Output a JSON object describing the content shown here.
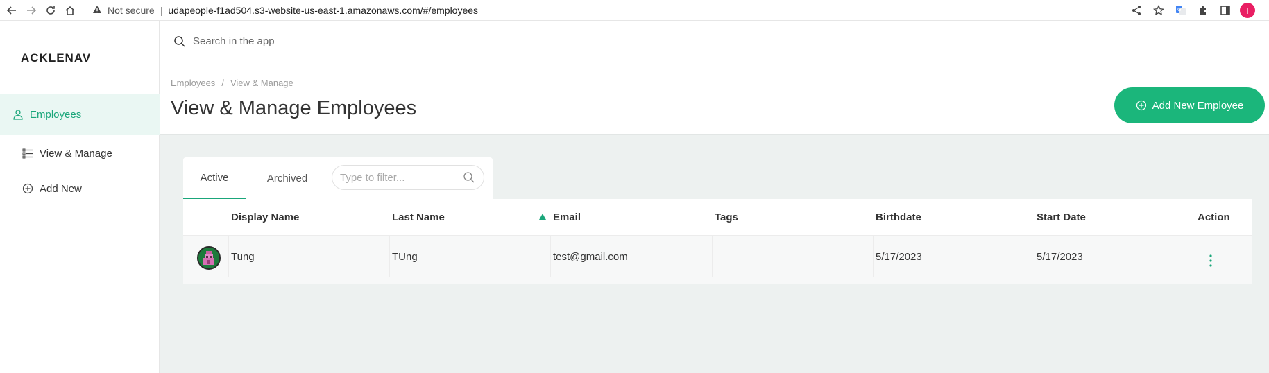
{
  "browser": {
    "security_label": "Not secure",
    "url": "udapeople-f1ad504.s3-website-us-east-1.amazonaws.com/#/employees",
    "profile_initial": "T"
  },
  "sidebar": {
    "logo": "ACKLENAVENUE",
    "items": [
      {
        "label": "Employees"
      },
      {
        "label": "View & Manage"
      },
      {
        "label": "Add New"
      }
    ]
  },
  "header": {
    "search_placeholder": "Search in the app",
    "breadcrumb": [
      "Employees",
      "View & Manage"
    ],
    "breadcrumb_separator": "/",
    "title": "View & Manage Employees",
    "add_button_label": "Add New Employee"
  },
  "tabs": [
    {
      "label": "Active",
      "selected": true
    },
    {
      "label": "Archived",
      "selected": false
    }
  ],
  "filter": {
    "placeholder": "Type to filter..."
  },
  "table": {
    "columns": [
      "Display Name",
      "Last Name",
      "Email",
      "Tags",
      "Birthdate",
      "Start Date",
      "Action"
    ],
    "rows": [
      {
        "display_name": "Tung",
        "last_name": "TUng",
        "email": "test@gmail.com",
        "tags": "",
        "birthdate": "5/17/2023",
        "start_date": "5/17/2023"
      }
    ]
  },
  "colors": {
    "accent": "#1bb67b",
    "active_green": "#1aa67a",
    "background": "#edf1f0"
  }
}
